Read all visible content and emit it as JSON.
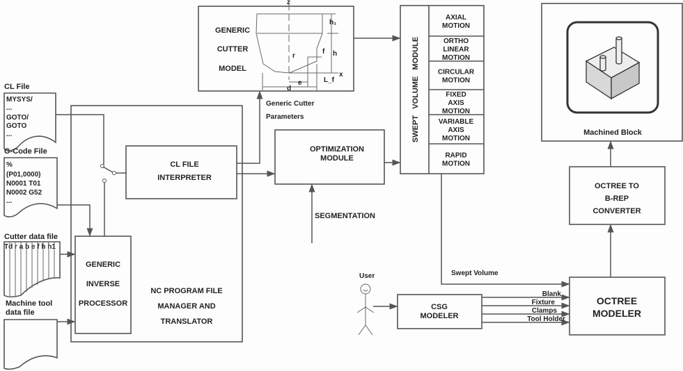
{
  "inputs": {
    "cl_file": {
      "label": "CL File",
      "lines": [
        "MYSYS/",
        "...",
        "GOTO/",
        "GOTO",
        "..."
      ]
    },
    "gcode_file": {
      "label": "G-Code File",
      "lines": [
        "%",
        "(P01,0000)",
        "N0001 T01",
        "N0002 G52",
        "..."
      ]
    },
    "cutter_data_file": {
      "label": "Cutter data file",
      "header": "Td r a b e f h h1"
    },
    "machine_tool_data_file": {
      "label_line1": "Machine tool",
      "label_line2": "data file"
    }
  },
  "nc_manager": {
    "lines": [
      "NC PROGRAM FILE",
      "MANAGER AND",
      "TRANSLATOR"
    ]
  },
  "inverse_processor": {
    "lines": [
      "GENERIC",
      "INVERSE",
      "PROCESSOR"
    ]
  },
  "cl_interpreter": {
    "lines": [
      "CL FILE",
      "INTERPRETER"
    ]
  },
  "cutter_model": {
    "lines": [
      "GENERIC",
      "CUTTER",
      "MODEL"
    ],
    "symbols": {
      "z": "z",
      "x": "x",
      "h1": "h₁",
      "h": "h",
      "r": "r",
      "e": "e",
      "d": "d",
      "lf": "L_f",
      "f": "f"
    }
  },
  "cutter_params": {
    "lines": [
      "Generic Cutter",
      "Parameters"
    ]
  },
  "optimization": {
    "lines": [
      "OPTIMIZATION",
      "MODULE"
    ]
  },
  "segmentation": "SEGMENTATION",
  "swept_volume_module": {
    "title": "SWEPT   VOLUME   MODULE",
    "motions": [
      [
        "AXIAL",
        "MOTION"
      ],
      [
        "ORTHO",
        "LINEAR",
        "MOTION"
      ],
      [
        "CIRCULAR",
        "MOTION"
      ],
      [
        "FIXED",
        "AXIS",
        "MOTION"
      ],
      [
        "VARIABLE",
        "AXIS",
        "MOTION"
      ],
      [
        "RAPID",
        "MOTION"
      ]
    ]
  },
  "swept_volume_label": "Swept Volume",
  "user": "User",
  "csg_modeler": {
    "lines": [
      "CSG",
      "MODELER"
    ]
  },
  "csg_outputs": [
    "Blank",
    "Fixture",
    "Clamps",
    "Tool Holder"
  ],
  "octree_modeler": {
    "lines": [
      "OCTREE",
      "MODELER"
    ]
  },
  "converter": {
    "lines": [
      "OCTREE TO",
      "B-REP",
      "CONVERTER"
    ]
  },
  "machined_block": "Machined Block"
}
